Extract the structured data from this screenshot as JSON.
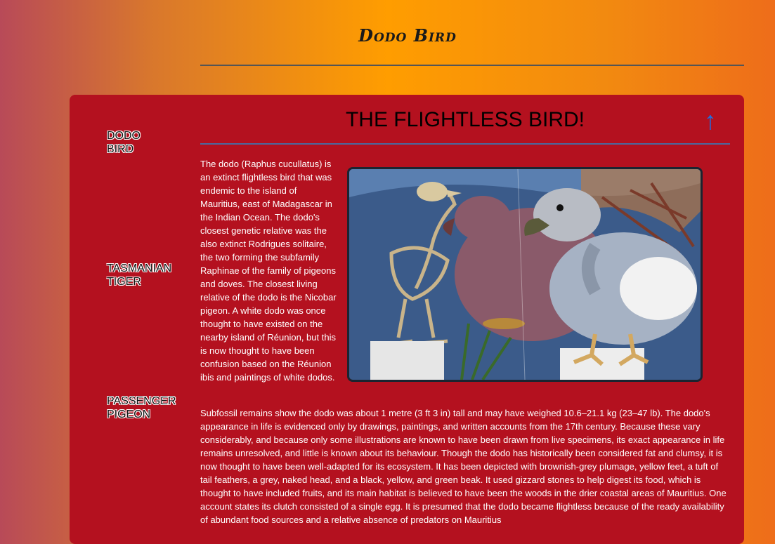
{
  "site": {
    "title": "Dodo Bird"
  },
  "nav": {
    "items": [
      {
        "label": "DODO\nBIRD"
      },
      {
        "label": "TASMANIAN\nTIGER"
      },
      {
        "label": "PASSENGER\nPIGEON"
      }
    ]
  },
  "article": {
    "heading": "THE FLIGHTLESS BIRD!",
    "back_to_top": "↑",
    "intro": "The dodo (Raphus cucullatus) is an extinct flightless bird that was endemic to the island of Mauritius, east of Madagascar in the Indian Ocean. The dodo's closest genetic relative was the also extinct Rodrigues solitaire, the two forming the subfamily Raphinae of the family of pigeons and doves. The closest living relative of the dodo is the Nicobar pigeon. A white dodo was once thought to have existed on the nearby island of Réunion, but this is now thought to have been confusion based on the Réunion ibis and paintings of white dodos.",
    "body": "Subfossil remains show the dodo was about 1 metre (3 ft 3 in) tall and may have weighed 10.6–21.1 kg (23–47 lb). The dodo's appearance in life is evidenced only by drawings, paintings, and written accounts from the 17th century. Because these vary considerably, and because only some illustrations are known to have been drawn from live specimens, its exact appearance in life remains unresolved, and little is known about its behaviour. Though the dodo has historically been considered fat and clumsy, it is now thought to have been well-adapted for its ecosystem. It has been depicted with brownish-grey plumage, yellow feet, a tuft of tail feathers, a grey, naked head, and a black, yellow, and green beak. It used gizzard stones to help digest its food, which is thought to have included fruits, and its main habitat is believed to have been the woods in the drier coastal areas of Mauritius. One account states its clutch consisted of a single egg. It is presumed that the dodo became flightless because of the ready availability of abundant food sources and a relative absence of predators on Mauritius"
  },
  "colors": {
    "panel": "#b4111f",
    "accent": "#1f6fe0"
  }
}
